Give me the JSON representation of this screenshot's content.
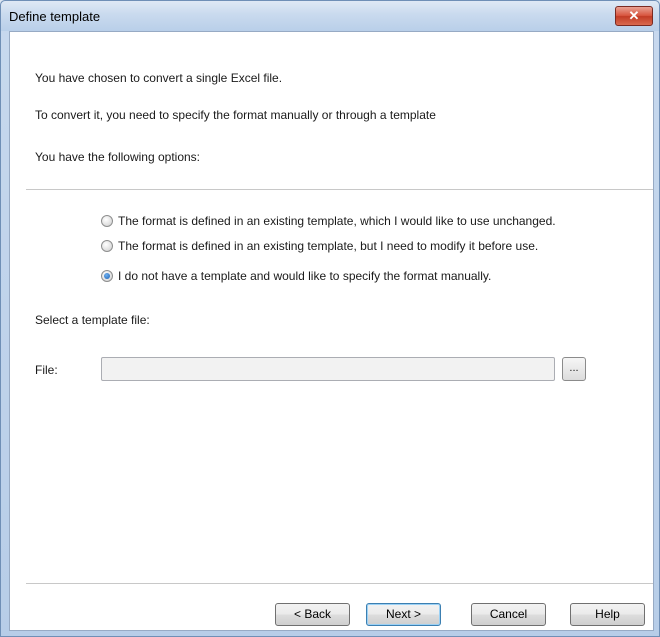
{
  "window": {
    "title": "Define template",
    "close_glyph": "✕"
  },
  "intro": {
    "line1": "You have chosen to convert a single Excel file.",
    "line2": "To convert it, you need to specify the format manually or through a template",
    "line3": "You have the following options:"
  },
  "options": [
    {
      "label": "The format is defined in an existing template, which I would like to use unchanged.",
      "selected": false
    },
    {
      "label": "The format is defined in an existing template, but I need to modify it before use.",
      "selected": false
    },
    {
      "label": "I do not have a template and would like to specify the format manually.",
      "selected": true
    }
  ],
  "template": {
    "prompt": "Select a template file:",
    "file_label": "File:",
    "file_value": "",
    "browse_label": "..."
  },
  "buttons": {
    "back": "< Back",
    "next": "Next >",
    "cancel": "Cancel",
    "help": "Help"
  }
}
